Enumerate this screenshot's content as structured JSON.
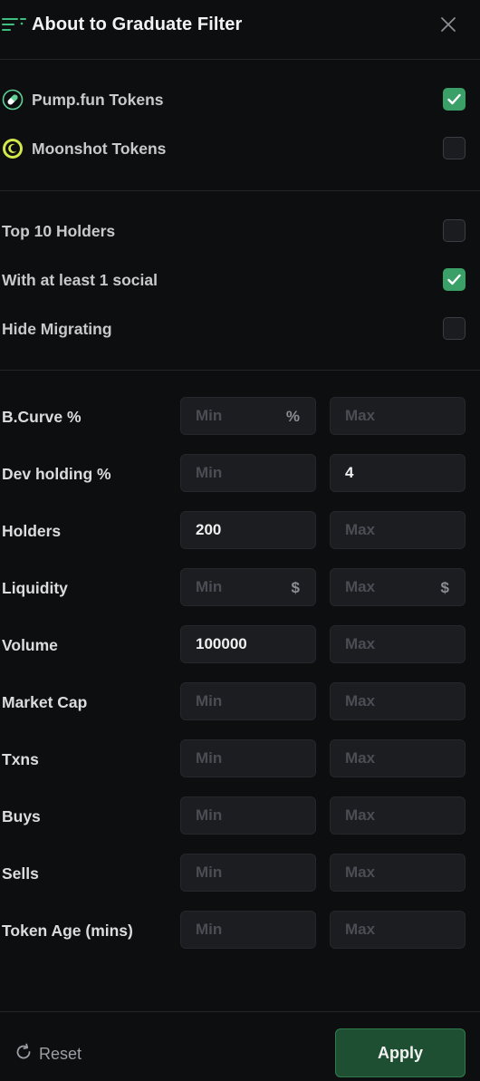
{
  "header": {
    "title": "About to Graduate Filter",
    "menu_icon": "filter-lines-icon",
    "close_icon": "close-icon"
  },
  "platforms": [
    {
      "label": "Pump.fun Tokens",
      "icon": "pill-icon",
      "checked": true
    },
    {
      "label": "Moonshot Tokens",
      "icon": "moon-icon",
      "checked": false
    }
  ],
  "toggles": [
    {
      "label": "Top 10 Holders",
      "checked": false
    },
    {
      "label": "With at least 1 social",
      "checked": true
    },
    {
      "label": "Hide Migrating",
      "checked": false
    }
  ],
  "ranges": [
    {
      "label": "B.Curve %",
      "min_placeholder": "Min",
      "max_placeholder": "Max",
      "min_value": "",
      "max_value": "",
      "min_suffix": "%",
      "max_suffix": ""
    },
    {
      "label": "Dev holding %",
      "min_placeholder": "Min",
      "max_placeholder": "Max",
      "min_value": "",
      "max_value": "4",
      "min_suffix": "",
      "max_suffix": ""
    },
    {
      "label": "Holders",
      "min_placeholder": "Min",
      "max_placeholder": "Max",
      "min_value": "200",
      "max_value": "",
      "min_suffix": "",
      "max_suffix": ""
    },
    {
      "label": "Liquidity",
      "min_placeholder": "Min",
      "max_placeholder": "Max",
      "min_value": "",
      "max_value": "",
      "min_suffix": "$",
      "max_suffix": "$"
    },
    {
      "label": "Volume",
      "min_placeholder": "Min",
      "max_placeholder": "Max",
      "min_value": "100000",
      "max_value": "",
      "min_suffix": "",
      "max_suffix": ""
    },
    {
      "label": "Market Cap",
      "min_placeholder": "Min",
      "max_placeholder": "Max",
      "min_value": "",
      "max_value": "",
      "min_suffix": "",
      "max_suffix": ""
    },
    {
      "label": "Txns",
      "min_placeholder": "Min",
      "max_placeholder": "Max",
      "min_value": "",
      "max_value": "",
      "min_suffix": "",
      "max_suffix": ""
    },
    {
      "label": "Buys",
      "min_placeholder": "Min",
      "max_placeholder": "Max",
      "min_value": "",
      "max_value": "",
      "min_suffix": "",
      "max_suffix": ""
    },
    {
      "label": "Sells",
      "min_placeholder": "Min",
      "max_placeholder": "Max",
      "min_value": "",
      "max_value": "",
      "min_suffix": "",
      "max_suffix": ""
    },
    {
      "label": "Token Age (mins)",
      "min_placeholder": "Min",
      "max_placeholder": "Max",
      "min_value": "",
      "max_value": "",
      "min_suffix": "",
      "max_suffix": ""
    }
  ],
  "footer": {
    "reset_label": "Reset",
    "reset_icon": "refresh-icon",
    "apply_label": "Apply"
  },
  "colors": {
    "background": "#0d0e10",
    "accent_green": "#3aa068",
    "apply_bg": "#1e4f33",
    "field_bg": "#1b1d21"
  }
}
